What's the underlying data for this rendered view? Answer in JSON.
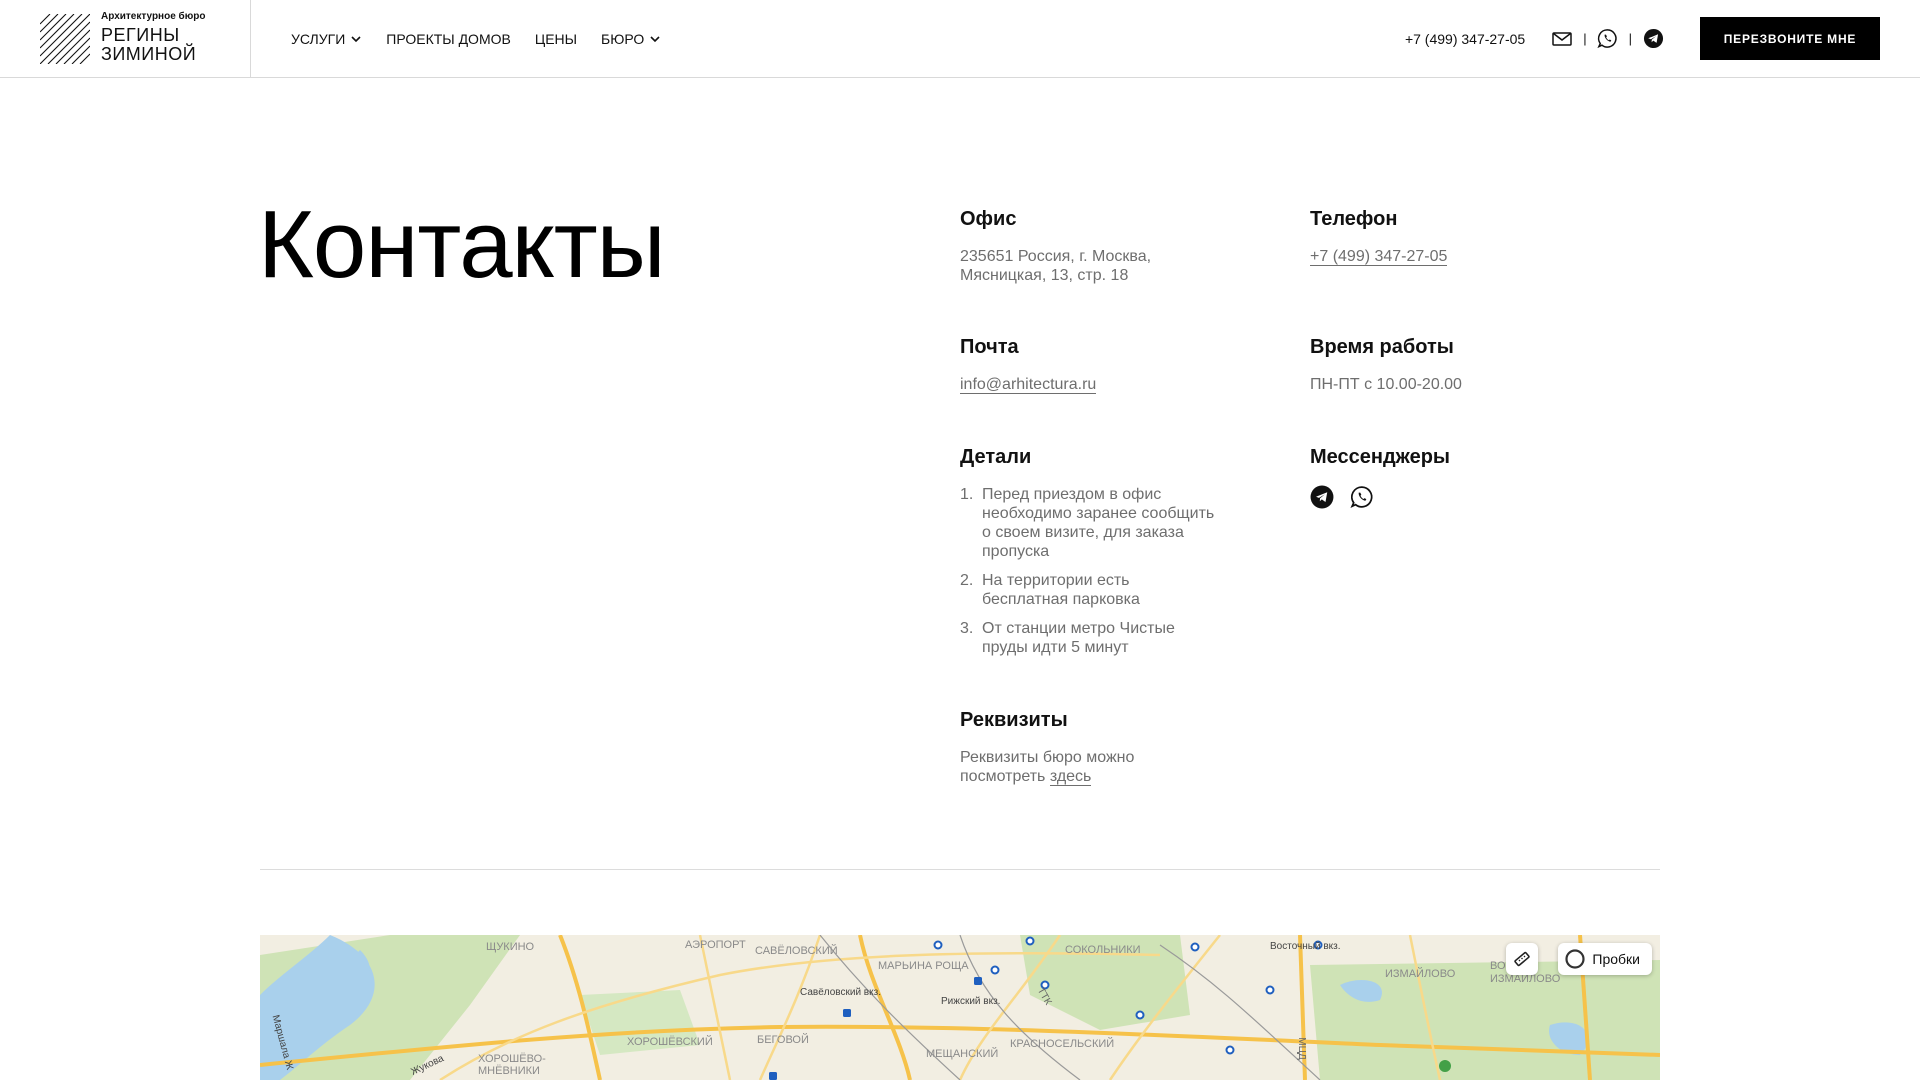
{
  "header": {
    "logo_caption": "Архитектурное бюро",
    "logo_name": "РЕГИНЫ ЗИМИНОЙ",
    "nav": [
      {
        "label": "УСЛУГИ",
        "dropdown": true
      },
      {
        "label": "ПРОЕКТЫ ДОМОВ",
        "dropdown": false
      },
      {
        "label": "ЦЕНЫ",
        "dropdown": false
      },
      {
        "label": "БЮРО",
        "dropdown": true
      }
    ],
    "phone": "+7 (499) 347-27-05",
    "separator": "|",
    "callback_label": "ПЕРЕЗВОНИТЕ МНЕ",
    "icons": [
      "mail-icon",
      "whatsapp-icon",
      "telegram-icon"
    ]
  },
  "page_title": "Контакты",
  "office": {
    "title": "Офис",
    "address": "235651 Россия, г. Москва, Мясницкая, 13, стр. 18"
  },
  "phone": {
    "title": "Телефон",
    "value": "+7 (499) 347-27-05"
  },
  "mail": {
    "title": "Почта",
    "value": "info@arhitectura.ru"
  },
  "hours": {
    "title": "Время работы",
    "value": "ПН-ПТ с 10.00-20.00"
  },
  "details": {
    "title": "Детали",
    "items": [
      {
        "num": "1.",
        "text": "Перед приездом в офис необходимо заранее сообщить о своем визите, для заказа пропуска"
      },
      {
        "num": "2.",
        "text": "На территории есть бесплатная парковка"
      },
      {
        "num": "3.",
        "text": "От станции метро Чистые пруды идти 5 минут"
      }
    ]
  },
  "messengers": {
    "title": "Мессенджеры",
    "icons": [
      "telegram-icon",
      "whatsapp-icon"
    ]
  },
  "requisites": {
    "title": "Реквизиты",
    "text": "Реквизиты бюро можно посмотреть",
    "link": "здесь"
  },
  "map": {
    "traffic_label": "Пробки",
    "labels": {
      "l1": "ЩУКИНО",
      "l2": "АЭРОПОРТ",
      "l3": "САВЁЛОВСКИЙ",
      "l4": "МАРЬИНА РОЩА",
      "l5": "СОКОЛЬНИКИ",
      "l6": "Восточный вкз.",
      "l7": "ИЗМАЙЛОВО",
      "l8": "ВОС ИЗМАЙЛОВО",
      "l9": "Савёловский вкз.",
      "l10": "Рижский вкз.",
      "l11": "ХОРОШЁВСКИЙ",
      "l12": "БЕГОВОЙ",
      "l13": "МЕЩАНСКИЙ",
      "l14": "КРАСНОСЕЛЬСКИЙ",
      "l15": "ХОРОШЁВО-МНЁВНИКИ",
      "l16": "ТТК",
      "l17": "МЦД",
      "l18": "Жукова",
      "l19": "Маршала Ж"
    }
  }
}
